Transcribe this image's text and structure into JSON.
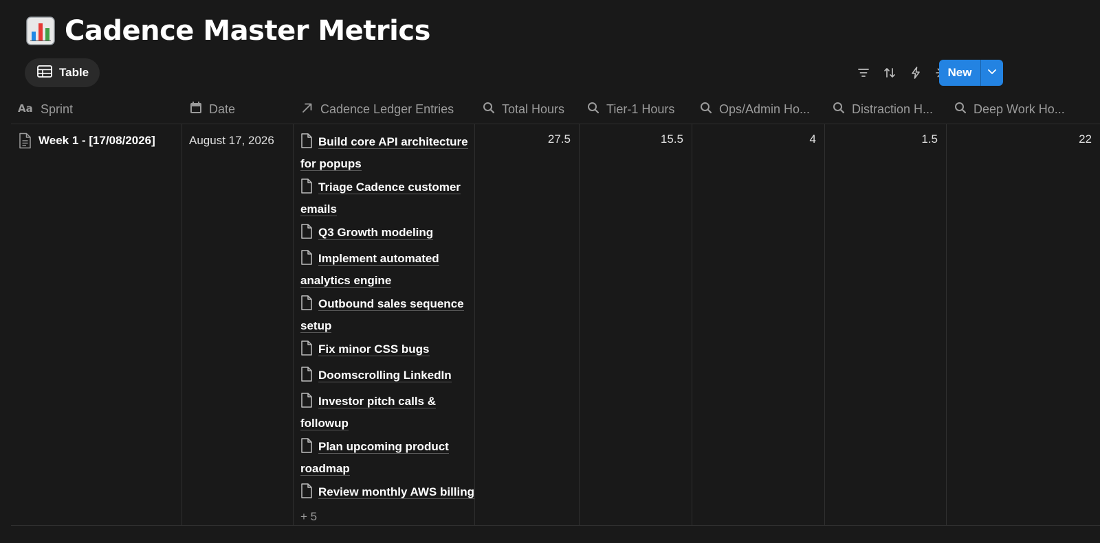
{
  "page": {
    "title": "Cadence Master Metrics",
    "title_icon": "bar-chart-emoji-icon"
  },
  "view": {
    "tab_label": "Table",
    "tab_icon": "table-icon"
  },
  "toolbar": {
    "icons": [
      "filter-icon",
      "sort-icon",
      "automation-icon",
      "ai-sparkle-icon",
      "search-icon",
      "settings-sliders-icon"
    ],
    "new_label": "New",
    "accent_color": "#2383e2"
  },
  "table": {
    "columns": [
      {
        "label": "Sprint",
        "icon": "title-aa-icon"
      },
      {
        "label": "Date",
        "icon": "calendar-icon"
      },
      {
        "label": "Cadence Ledger Entries",
        "icon": "relation-arrow-icon"
      },
      {
        "label": "Total Hours",
        "icon": "rollup-search-icon"
      },
      {
        "label": "Tier-1 Hours",
        "icon": "rollup-search-icon"
      },
      {
        "label": "Ops/Admin Ho...",
        "icon": "rollup-search-icon"
      },
      {
        "label": "Distraction H...",
        "icon": "rollup-search-icon"
      },
      {
        "label": "Deep Work Ho...",
        "icon": "rollup-search-icon"
      }
    ],
    "rows": [
      {
        "sprint": "Week 1 - [17/08/2026]",
        "date": "August 17, 2026",
        "entries": [
          "Build core API architecture for popups",
          "Triage Cadence customer emails",
          "Q3 Growth modeling",
          "Implement automated analytics engine",
          "Outbound sales sequence setup",
          "Fix minor CSS bugs",
          "Doomscrolling LinkedIn",
          "Investor pitch calls & followup",
          "Plan upcoming product roadmap",
          "Review monthly AWS billing"
        ],
        "more": "+ 5",
        "total_hours": "27.5",
        "tier1_hours": "15.5",
        "ops_admin_hours": "4",
        "distraction_hours": "1.5",
        "deep_work_hours": "22"
      }
    ]
  }
}
